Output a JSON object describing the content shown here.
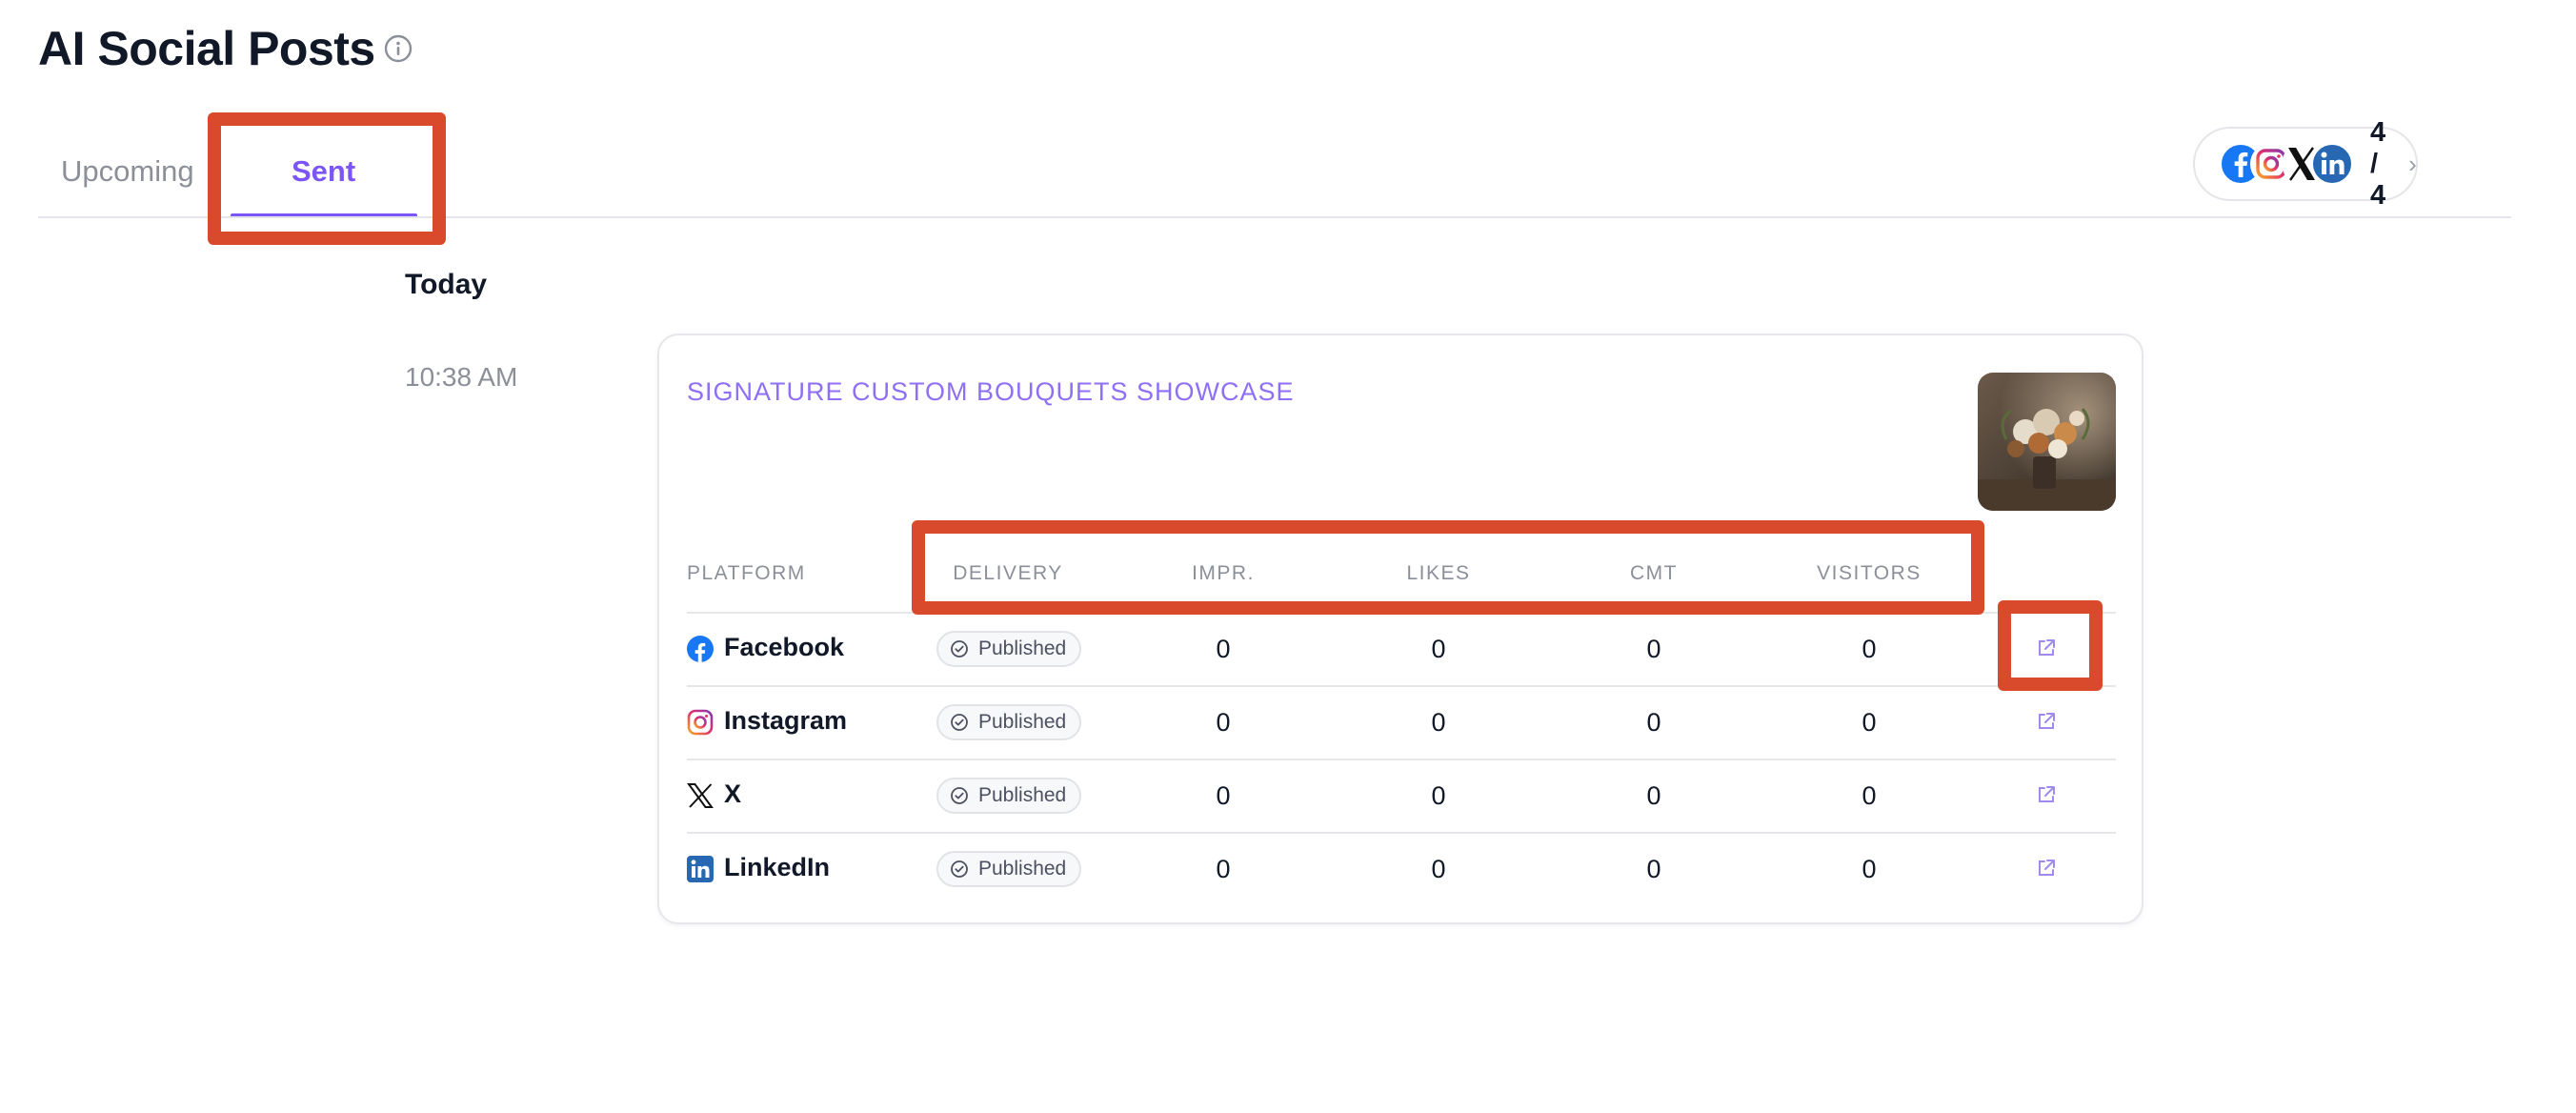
{
  "header": {
    "title": "AI Social Posts",
    "info_icon": "info-circle-icon"
  },
  "tabs": [
    {
      "label": "Upcoming",
      "active": false
    },
    {
      "label": "Sent",
      "active": true
    }
  ],
  "accounts": {
    "avatars": [
      "facebook-icon",
      "instagram-icon",
      "x-icon",
      "linkedin-icon"
    ],
    "count": "4 / 4",
    "chevron": "›"
  },
  "timeline": {
    "day": "Today",
    "time": "10:38 AM"
  },
  "post": {
    "title": "SIGNATURE CUSTOM BOUQUETS SHOWCASE",
    "thumbnail": "flower-bouquet-image",
    "columns": [
      "PLATFORM",
      "DELIVERY",
      "IMPR.",
      "LIKES",
      "CMT",
      "VISITORS"
    ],
    "rows": [
      {
        "platform": "Facebook",
        "icon": "facebook-icon",
        "delivery": "Published",
        "impr": "0",
        "likes": "0",
        "cmt": "0",
        "visitors": "0"
      },
      {
        "platform": "Instagram",
        "icon": "instagram-icon",
        "delivery": "Published",
        "impr": "0",
        "likes": "0",
        "cmt": "0",
        "visitors": "0"
      },
      {
        "platform": "X",
        "icon": "x-icon",
        "delivery": "Published",
        "impr": "0",
        "likes": "0",
        "cmt": "0",
        "visitors": "0"
      },
      {
        "platform": "LinkedIn",
        "icon": "linkedin-icon",
        "delivery": "Published",
        "impr": "0",
        "likes": "0",
        "cmt": "0",
        "visitors": "0"
      }
    ]
  },
  "colors": {
    "accent": "#7c55f5",
    "title_accent": "#8f6ff5",
    "highlight": "#d94a2c",
    "facebook": "#1877f2",
    "linkedin": "#2867b2"
  }
}
